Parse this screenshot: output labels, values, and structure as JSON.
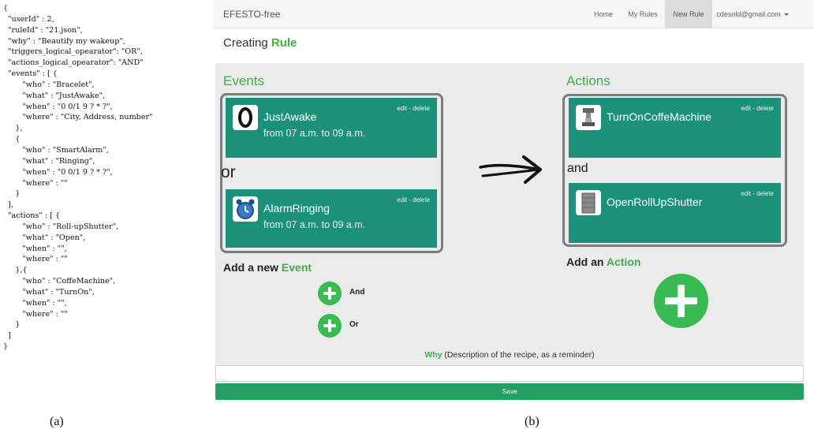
{
  "code_panel": {
    "lines": [
      "{",
      "  \"userId\" : 2,",
      "  \"ruleId\" : \"21.json\",",
      "  \"why\" : \"Beautify my wakeup\",",
      "  \"triggers_logical_opearator\": \"OR\",",
      "  \"actions_logical_opearator\": \"AND\"",
      "  \"events\" : [ {",
      "        \"who\" : \"Bracelet\",",
      "        \"what\" : \"JustAwake\",",
      "        \"when\" : \"0 0/1 9 ? * ?\",",
      "        \"where\" : \"City, Address, number\"",
      "     },",
      "     {",
      "        \"who\" : \"SmartAlarm\",",
      "        \"what\" : \"Ringing\",",
      "        \"when\" : \"0 0/1 9 ? * ?\",",
      "        \"where\" : \"\"",
      "     }",
      "  ],",
      "  \"actions\" : [ {",
      "        \"who\" : \"Roll-upShutter\",",
      "        \"what\" : \"Open\",",
      "        \"when\" : \"\",",
      "        \"where\" : \"\"",
      "     },{",
      "        \"who\" : \"CoffeMachine\",",
      "        \"what\" : \"TurnOn\",",
      "        \"when\" : \"\",",
      "        \"where\" : \"\"",
      "     }",
      "  ]",
      "}"
    ]
  },
  "labels": {
    "a": "(a)",
    "b": "(b)"
  },
  "navbar": {
    "brand": "EFESTO-free",
    "items": [
      "Home",
      "My Rules",
      "New Rule"
    ],
    "user": "cdesold@gmail.com"
  },
  "page": {
    "title_prefix": "Creating",
    "title_accent": "Rule"
  },
  "events": {
    "heading": "Events",
    "operator": "or",
    "cards": [
      {
        "title": "JustAwake",
        "time": "from 07 a.m. to 09 a.m.",
        "edit": "edit - delete",
        "icon": "bracelet-icon"
      },
      {
        "title": "AlarmRinging",
        "time": "from 07 a.m. to 09 a.m.",
        "edit": "edit - delete",
        "icon": "alarm-clock-icon"
      }
    ],
    "add_prefix": "Add a new",
    "add_accent": "Event",
    "and_label": "And",
    "or_label": "Or"
  },
  "actions": {
    "heading": "Actions",
    "operator": "and",
    "cards": [
      {
        "title": "TurnOnCoffeMachine",
        "edit": "edit - delete",
        "icon": "coffee-machine-icon"
      },
      {
        "title": "OpenRollUpShutter",
        "edit": "edit - delete",
        "icon": "shutter-icon"
      }
    ],
    "add_prefix": "Add an",
    "add_accent": "Action"
  },
  "why": {
    "accent": "Why",
    "text": " (Description of the recipe, as a reminder)",
    "input_value": ""
  },
  "save_label": "Save",
  "colors": {
    "accent_green": "#3fae49",
    "card_teal": "#1a9178",
    "save_green": "#24a062",
    "plus_green": "#39ba52"
  }
}
